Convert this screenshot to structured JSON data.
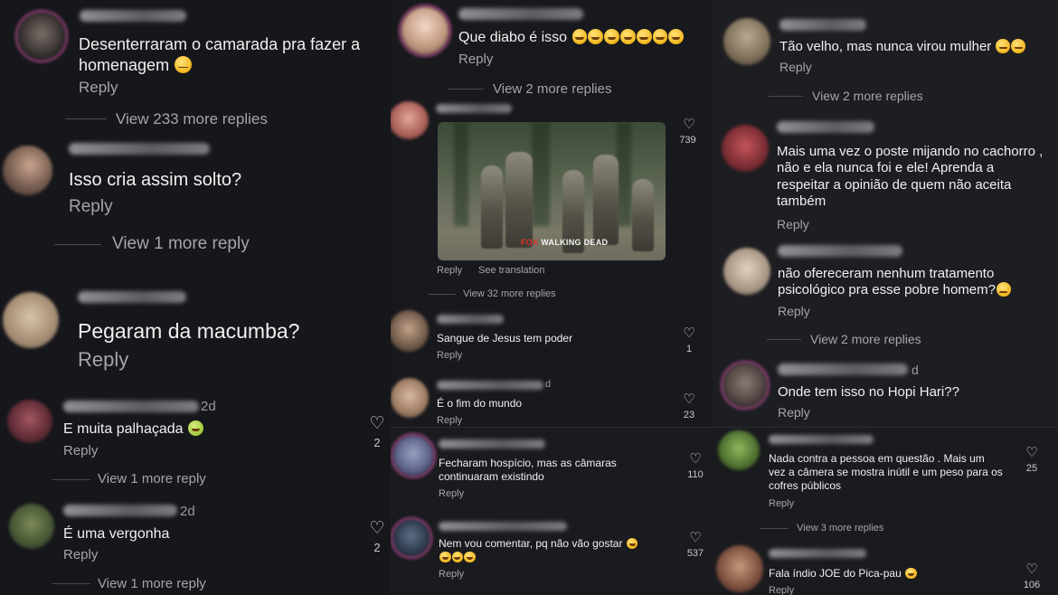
{
  "icons": {
    "like": "heart-outline-icon",
    "emoji_laugh": "grinning-sweat-emoji",
    "emoji_sad": "crying-face-emoji",
    "emoji_sick": "nauseated-face-emoji"
  },
  "colors": {
    "background": "#16171b",
    "text": "#f0f0f0",
    "muted": "#a4a5aa",
    "story_ring": "#b04a8c"
  },
  "panel1": {
    "c1": {
      "text": "Desenterraram o camarada pra fazer a homenagem",
      "reply": "Reply",
      "view_more": "View 233 more replies"
    },
    "c2": {
      "text": "Isso cria assim solto?",
      "reply": "Reply",
      "view_more": "View 1 more reply"
    },
    "c3": {
      "text": "Pegaram da macumba?",
      "reply": "Reply"
    },
    "c4": {
      "time": "2d",
      "text": "E muita palhaçada",
      "reply": "Reply",
      "likes": "2",
      "view_more": "View 1 more reply"
    },
    "c5": {
      "time": "2d",
      "text": "É uma vergonha",
      "reply": "Reply",
      "likes": "2",
      "view_more": "View 1 more reply"
    }
  },
  "panel2": {
    "c1": {
      "text": "Que diabo é isso",
      "reply": "Reply",
      "view_more": "View 2 more replies"
    },
    "c2": {
      "likes": "739",
      "gif_brand": "FOX",
      "gif_title": "WALKING DEAD",
      "reply": "Reply",
      "see_translation": "See translation",
      "view_more": "View 32 more replies"
    },
    "c3": {
      "text": "Sangue de Jesus tem poder",
      "reply": "Reply",
      "likes": "1"
    },
    "c4": {
      "time": "d",
      "text": "É o fim do mundo",
      "reply": "Reply",
      "likes": "23"
    }
  },
  "panel3": {
    "c1": {
      "text": "Fecharam hospício, mas as câmaras continuaram existindo",
      "reply": "Reply",
      "likes": "110"
    },
    "c2": {
      "text": "Nem vou comentar, pq não vão gostar",
      "reply": "Reply",
      "likes": "537"
    }
  },
  "panel4": {
    "c1": {
      "text": "Tão velho, mas nunca virou mulher",
      "reply": "Reply",
      "view_more": "View 2 more replies"
    },
    "c2": {
      "text": "Mais uma vez o poste mijando no cachorro , não e ela nunca foi e ele! Aprenda a respeitar a opinião de quem não aceita também",
      "reply": "Reply"
    },
    "c3": {
      "text": "não ofereceram nenhum tratamento psicológico pra esse pobre homem?",
      "reply": "Reply",
      "view_more": "View 2 more replies"
    },
    "c4": {
      "time": "d",
      "text": "Onde tem isso no Hopi Hari??",
      "reply": "Reply"
    }
  },
  "panel5": {
    "c1": {
      "text": "Nada contra a pessoa em questão . Mais um vez a câmera se mostra inútil e um peso para os cofres públicos",
      "reply": "Reply",
      "likes": "25",
      "view_more": "View 3 more replies"
    },
    "c2": {
      "text": "Fala índio JOE do Pica-pau",
      "reply": "Reply",
      "likes": "106"
    }
  }
}
